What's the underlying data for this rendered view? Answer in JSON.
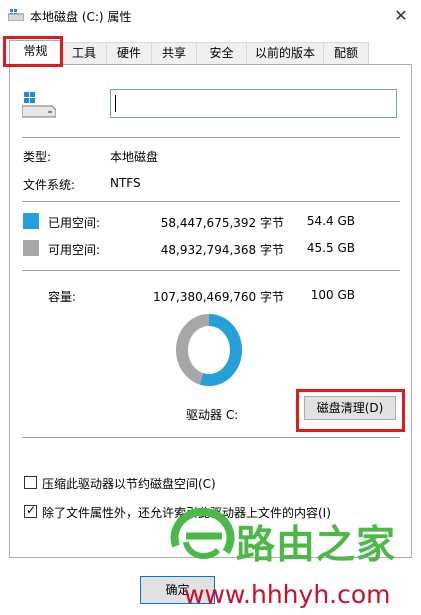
{
  "window": {
    "title": "本地磁盘 (C:) 属性",
    "close_glyph": "✕"
  },
  "tabs": [
    {
      "label": "常规",
      "active": true
    },
    {
      "label": "工具"
    },
    {
      "label": "硬件"
    },
    {
      "label": "共享"
    },
    {
      "label": "安全"
    },
    {
      "label": "以前的版本"
    },
    {
      "label": "配额"
    }
  ],
  "general": {
    "name_value": "",
    "type_label": "类型:",
    "type_value": "本地磁盘",
    "fs_label": "文件系统:",
    "fs_value": "NTFS",
    "used": {
      "label": "已用空间:",
      "bytes": "58,447,675,392 字节",
      "size": "54.4 GB",
      "color": "#26a0da"
    },
    "free": {
      "label": "可用空间:",
      "bytes": "48,932,794,368 字节",
      "size": "45.5 GB",
      "color": "#a7a7a7"
    },
    "capacity": {
      "label": "容量:",
      "bytes": "107,380,469,760 字节",
      "size": "100 GB"
    },
    "used_fraction": 0.544,
    "drive_label": "驱动器 C:",
    "cleanup_button": "磁盘清理(D)",
    "compress_checkbox": {
      "label": "压缩此驱动器以节约磁盘空间(C)",
      "checked": false
    },
    "index_checkbox": {
      "label": "除了文件属性外，还允许索引此驱动器上文件的内容(I)",
      "checked": true
    }
  },
  "footer": {
    "ok_label": "确定"
  },
  "annotation_color": "#e0191c",
  "watermark": {
    "text": "路由之家",
    "url": "www.hhhyh.com",
    "brand_green": "#4cb848",
    "brand_red": "#c8102e"
  }
}
